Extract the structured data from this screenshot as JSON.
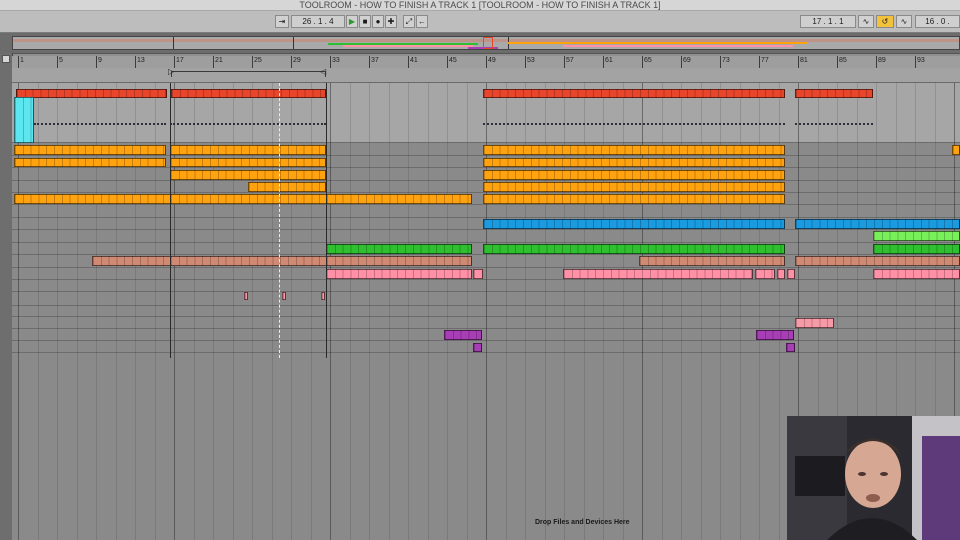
{
  "window": {
    "title": "TOOLROOM - HOW TO FINISH A TRACK 1  [TOOLROOM - HOW TO FINISH A TRACK 1]"
  },
  "transport": {
    "arrangement_position": "26 .  1 .  4",
    "loop_start": "17 .  1 .  1",
    "loop_length": "16 .  0 ."
  },
  "ruler": {
    "bars": [
      "1",
      "5",
      "9",
      "13",
      "17",
      "21",
      "25",
      "29",
      "33",
      "37",
      "41",
      "45",
      "49",
      "53",
      "57",
      "61",
      "65",
      "69",
      "73",
      "77",
      "81",
      "85",
      "89",
      "93"
    ]
  },
  "status": {
    "drop_hint": "Drop Files and Devices Here"
  },
  "colors": {
    "red": "#e8452b",
    "orange": "#ffa20f",
    "cyan": "#5ce7f0",
    "blue": "#1a9ae0",
    "green": "#2ec02e",
    "lime": "#78f05a",
    "salmon": "#d08a74",
    "pink": "#ff90a5",
    "purple": "#a83eb5",
    "light_pink": "#f59aa6"
  }
}
